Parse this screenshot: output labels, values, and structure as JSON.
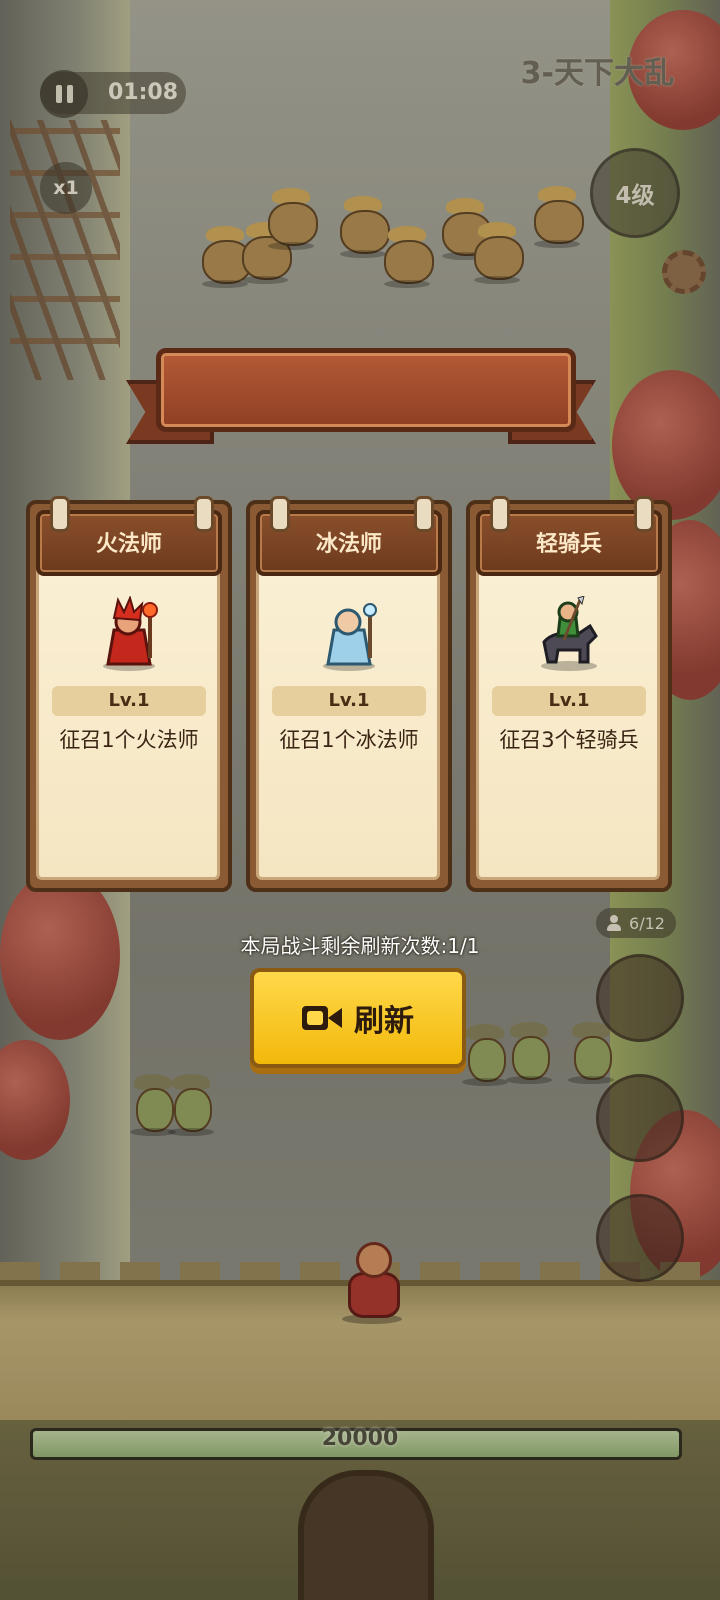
{
  "hud": {
    "timer": "01:08",
    "speed": "x1",
    "stage_title": "3-天下大乱",
    "hero_level": "4级",
    "troops": "6/12",
    "wall_hp": "20000",
    "wall_hp_fraction": 1.0
  },
  "dialog": {
    "banner_title": "",
    "cards": [
      {
        "name": "火法师",
        "level": "Lv.1",
        "desc": "征召1个火法师"
      },
      {
        "name": "冰法师",
        "level": "Lv.1",
        "desc": "征召1个冰法师"
      },
      {
        "name": "轻骑兵",
        "level": "Lv.1",
        "desc": "征召3个轻骑兵"
      }
    ],
    "refresh_info": "本局战斗剩余刷新次数:1/1",
    "refresh_label": "刷新"
  },
  "colors": {
    "refresh_button": "#ffd84a",
    "banner": "#b45a35",
    "card_paper": "#fbf0d6"
  }
}
